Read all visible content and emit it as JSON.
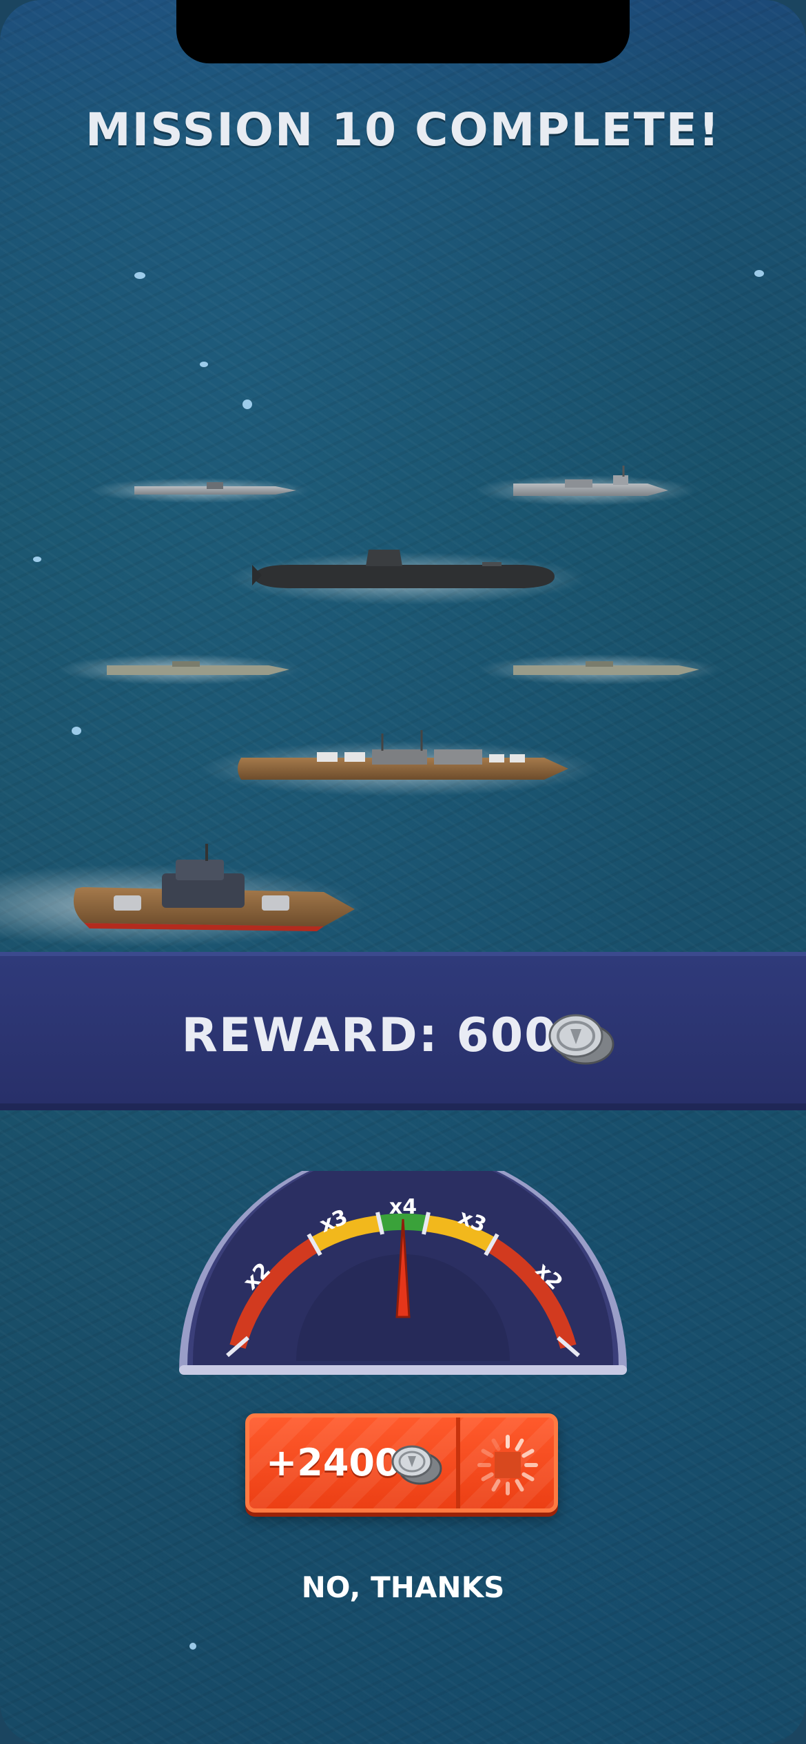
{
  "screen": {
    "title": "MISSION 10 COMPLETE!"
  },
  "reward": {
    "label": "REWARD: 600",
    "currency_icon": "silver-coins-icon"
  },
  "multiplier_gauge": {
    "segments": [
      "x2",
      "x3",
      "x4",
      "x3",
      "x2"
    ],
    "segment_colors": [
      "#d23a1f",
      "#f2b81c",
      "#3aa23a",
      "#f2b81c",
      "#d23a1f"
    ],
    "needle_at": "x4"
  },
  "bonus_button": {
    "label": "+2400",
    "currency_icon": "silver-coins-icon",
    "status_icon": "loading-spinner-icon",
    "color": "#ec3f14"
  },
  "dismiss": {
    "label": "NO, THANKS"
  },
  "fleet": {
    "ships": [
      "destroyer",
      "frigate",
      "submarine",
      "cruiser",
      "cruiser",
      "battleship",
      "battleship"
    ]
  }
}
